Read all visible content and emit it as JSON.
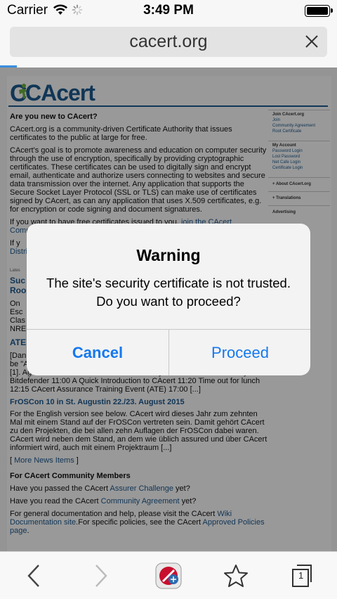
{
  "status": {
    "carrier": "Carrier",
    "time": "3:49 PM"
  },
  "browser": {
    "url": "cacert.org",
    "tab_count": "1"
  },
  "page": {
    "logo": "CAcert",
    "heading": "Are you new to CAcert?",
    "intro": "CAcert.org is a community-driven Certificate Authority that issues certificates to the public at large for free.",
    "goal": "CAcert's goal is to promote awareness and education on computer security through the use of encryption, specifically by providing cryptographic certificates. These certificates can be used to digitally sign and encrypt email, authenticate and authorize users connecting to websites and secure data transmission over the internet. Any application that supports the Secure Socket Layer Protocol (SSL or TLS) can make use of certificates signed by CAcert, as can any application that uses X.509 certificates, e.g. for encryption or code signing and document signatures.",
    "free_certs_prefix": "If you want to have free certificates issued to you,",
    "free_certs_link": "join the CAcert",
    "comm_partial": "Comm",
    "if_partial": "If y",
    "distr_partial": "Distri",
    "latest_label": "Lates",
    "news1_partial": "Suc",
    "news1b_partial": "Roo",
    "news_body_lines": [
      "On",
      "Esc",
      "Clas",
      "NRE"
    ],
    "ate_partial": "ATE",
    "dan_partial": "[Dan",
    "be_partial": "be \"A",
    "agenda": "[1]. Agenda 10:00 Welcome 10:15 A Security status on the Internet by Bitdefender 11:00 A Quick Introduction to CAcert 11:20 Time out for lunch 12:15 CAcert Assurance Training Event (ATE) 17:00 [...]",
    "froscon_title": "FrOSCon 10 in St. Augustin 22./23. August 2015",
    "froscon_body": "For the English version see below. CAcert wird dieses Jahr zum zehnten Mal mit einem Stand auf der FrOSCon vertreten sein. Damit gehört CAcert zu den Projekten, die bei allen zehn Auflagen der FrOSCon dabei waren. CAcert wird neben dem Stand, an dem wie üblich assured und über CAcert informiert wird, auch mit einem Projektraum [...]",
    "more_news": "More News Items",
    "community_heading": "For CAcert Community Members",
    "assurer_prefix": "Have you passed the CAcert",
    "assurer_link": "Assurer Challenge",
    "assurer_suffix": "yet?",
    "agreement_prefix": "Have you read the CAcert",
    "agreement_link": "Community Agreement",
    "agreement_suffix": "yet?",
    "docs_prefix": "For general documentation and help, please visit the CAcert",
    "docs_link": "Wiki Documentation site",
    "docs_mid": ".For specific policies, see the CAcert",
    "docs_link2": "Approved Policies page",
    "docs_end": "."
  },
  "sidebar": {
    "join_title": "Join CAcert.org",
    "join_items": [
      "Join",
      "Community Agreement",
      "Root Certificate"
    ],
    "account_title": "My Account",
    "account_items": [
      "Password Login",
      "Lost Password",
      "Net Cafe Login",
      "Certificate Login"
    ],
    "about": "+ About CAcert.org",
    "translations": "+ Translations",
    "advertising": "Advertising"
  },
  "dialog": {
    "title": "Warning",
    "message_line1": "The site's security certificate is not trusted.",
    "message_line2": "Do you want to proceed?",
    "cancel": "Cancel",
    "proceed": "Proceed"
  },
  "colors": {
    "accent": "#1478f0",
    "brand": "#1d5a8f"
  }
}
